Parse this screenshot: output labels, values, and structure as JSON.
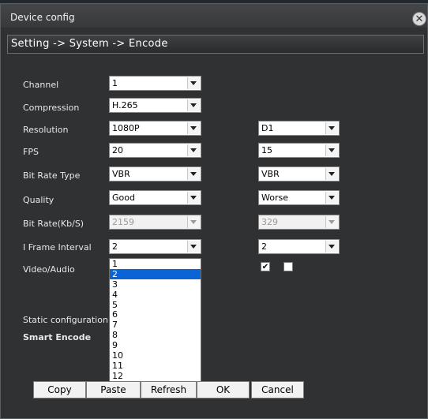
{
  "window": {
    "title": "Device config",
    "close_glyph": "✕"
  },
  "breadcrumb": "Setting -> System -> Encode",
  "rows": {
    "channel": {
      "label": "Channel",
      "main": "1"
    },
    "compression": {
      "label": "Compression",
      "main": "H.265"
    },
    "resolution": {
      "label": "Resolution",
      "main": "1080P",
      "sub": "D1"
    },
    "fps": {
      "label": "FPS",
      "main": "20",
      "sub": "15"
    },
    "bitrate_type": {
      "label": "Bit Rate Type",
      "main": "VBR",
      "sub": "VBR"
    },
    "quality": {
      "label": "Quality",
      "main": "Good",
      "sub": "Worse"
    },
    "bitrate": {
      "label": "Bit Rate(Kb/S)",
      "main": "2159",
      "sub": "329"
    },
    "iframe": {
      "label": "I Frame Interval",
      "main": "2",
      "sub": "2"
    },
    "video_audio": {
      "label": "Video/Audio",
      "main_checked": "✔",
      "sub_checked": ""
    }
  },
  "static_config_label": "Static configuration of",
  "smart_encode_label": "Smart Encode",
  "iframe_dropdown": {
    "selected": "2",
    "options": [
      "1",
      "2",
      "3",
      "4",
      "5",
      "6",
      "7",
      "8",
      "9",
      "10",
      "11",
      "12"
    ]
  },
  "buttons": {
    "copy": "Copy",
    "paste": "Paste",
    "refresh": "Refresh",
    "ok": "OK",
    "cancel": "Cancel"
  },
  "colors": {
    "selection": "#0a64d6",
    "dialog_bg": "#2f3133"
  }
}
